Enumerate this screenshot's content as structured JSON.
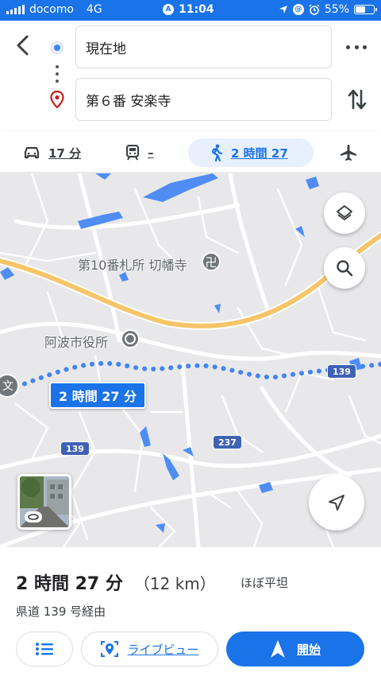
{
  "status_bar": {
    "carrier": "docomo",
    "network": "4G",
    "time": "11:04",
    "battery": "55%",
    "battery_level": 0.55
  },
  "directions": {
    "origin": "現在地",
    "destination": "第６番 安楽寺"
  },
  "travel_modes": [
    {
      "mode": "car",
      "icon": "car-icon",
      "label": "17 分"
    },
    {
      "mode": "transit",
      "icon": "train-icon",
      "label": "–"
    },
    {
      "mode": "walk",
      "icon": "walk-icon",
      "label": "2 時間 27",
      "selected": true
    },
    {
      "mode": "flight",
      "icon": "airplane-icon",
      "label": ""
    }
  ],
  "map": {
    "place_labels": {
      "temple": "第10番札所 切幡寺",
      "city_office": "阿波市役所"
    },
    "school_symbol": "文",
    "road_shields": {
      "r139_right": "139",
      "r139_left": "139",
      "r237": "237"
    },
    "route_label": "2 時間 27 分",
    "colors": {
      "route": "#4285f4",
      "water": "#4f8df5",
      "highway": "#f6c56a"
    }
  },
  "summary": {
    "duration": "2 時間 27 分",
    "distance": "（12 km）",
    "terrain": "ほぼ平坦",
    "via": "県道 139 号経由"
  },
  "actions": {
    "live_view": "ライブビュー",
    "start": "開始"
  },
  "colors": {
    "accent": "#1a73e8"
  }
}
